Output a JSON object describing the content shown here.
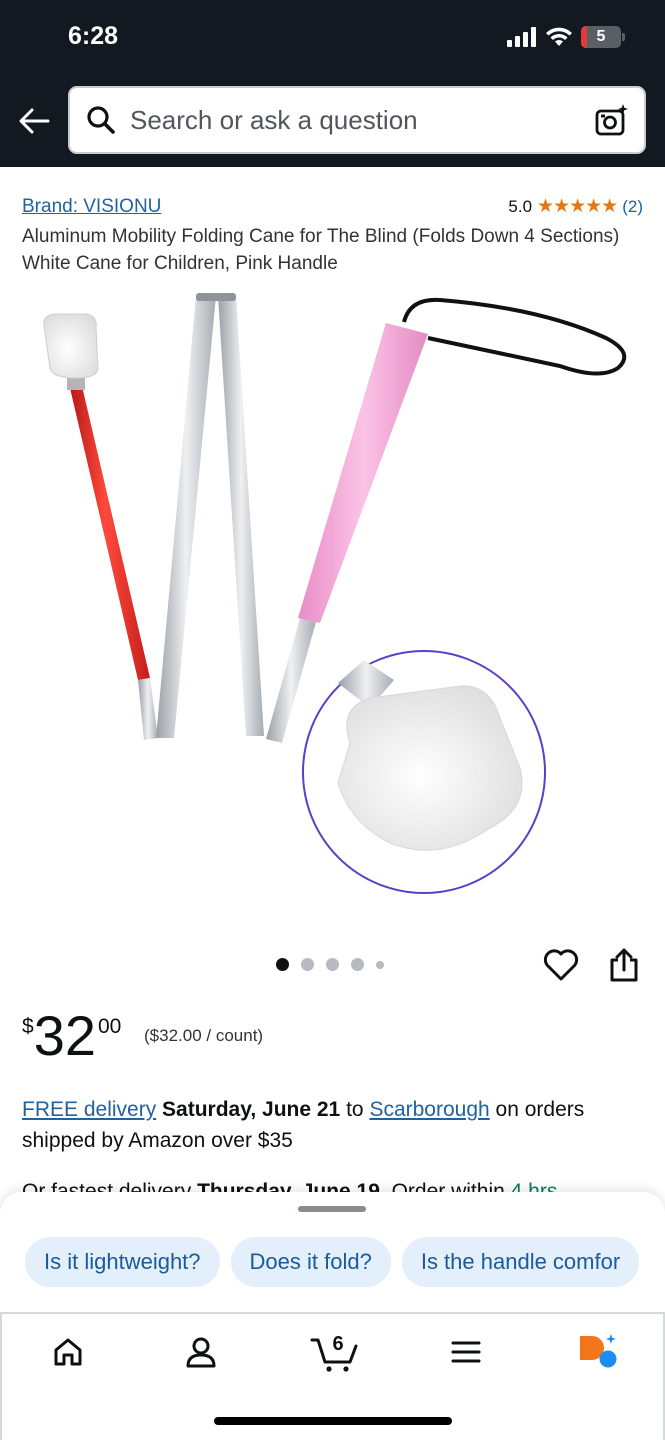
{
  "status_bar": {
    "time": "6:28",
    "battery": "5"
  },
  "header": {
    "search_placeholder": "Search or ask a question"
  },
  "product": {
    "brand": "Brand: VISIONU",
    "rating": "5.0",
    "stars": "★★★★★",
    "rating_count": "(2)",
    "title": "Aluminum Mobility Folding Cane for The Blind (Folds Down 4 Sections) White Cane for Children, Pink Handle",
    "image_count": 5,
    "active_image": 1
  },
  "price": {
    "symbol": "$",
    "whole": "32",
    "fraction": "00",
    "unit_price": "($32.00 / count)"
  },
  "delivery": {
    "free_delivery": "FREE delivery",
    "date": "Saturday, June 21",
    "to": "to",
    "location": "Scarborough",
    "rest": "on orders shipped by Amazon over $35",
    "fastest_prefix": "Or fastest delivery",
    "fastest_date": "Thursday, June 19",
    "order_within": ". Order within",
    "countdown": "4 hrs"
  },
  "suggestions": [
    "Is it lightweight?",
    "Does it fold?",
    "Is the handle comfor"
  ],
  "tabbar": {
    "cart_count": "6"
  },
  "colors": {
    "header_bg": "#131921",
    "link": "#2162a1",
    "star": "#e47911",
    "chip_bg": "#e3effa",
    "chip_text": "#1b5a9b",
    "ai_orange": "#f3761c",
    "ai_blue": "#1c8df3"
  }
}
